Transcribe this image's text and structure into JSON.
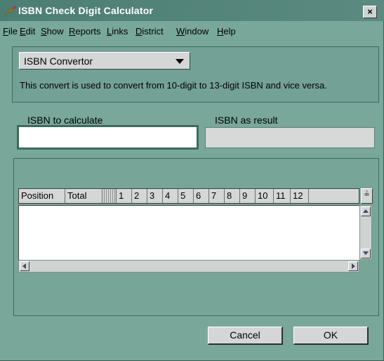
{
  "window": {
    "title": "ISBN Check Digit Calculator",
    "close_label": "×"
  },
  "menu": [
    {
      "label": "File",
      "accel": "F",
      "rest": "ile"
    },
    {
      "label": "Edit",
      "accel": "E",
      "rest": "dit"
    },
    {
      "label": "Show",
      "accel": "S",
      "rest": "how"
    },
    {
      "label": "Reports",
      "accel": "R",
      "rest": "eports"
    },
    {
      "label": "Links",
      "accel": "L",
      "rest": "inks"
    },
    {
      "label": "District",
      "accel": "D",
      "rest": "istrict"
    },
    {
      "label": "Window",
      "accel": "W",
      "rest": "indow"
    },
    {
      "label": "Help",
      "accel": "H",
      "rest": "elp"
    }
  ],
  "convertor": {
    "selected": "ISBN Convertor",
    "description": "This convert is used to convert from 10-digit to 13-digit ISBN and vice versa."
  },
  "fields": {
    "calc_label": "ISBN to calculate",
    "calc_value": "",
    "result_label": "ISBN as result",
    "result_value": ""
  },
  "grid": {
    "columns": [
      "Position",
      "Total",
      "",
      "1",
      "2",
      "3",
      "4",
      "5",
      "6",
      "7",
      "8",
      "9",
      "10",
      "11",
      "12"
    ],
    "rows": []
  },
  "buttons": {
    "cancel": "Cancel",
    "ok": "OK"
  },
  "colors": {
    "window_bg": "#79a89b",
    "titlebar": "#4d7e74",
    "field_border": "#3e6a60"
  }
}
